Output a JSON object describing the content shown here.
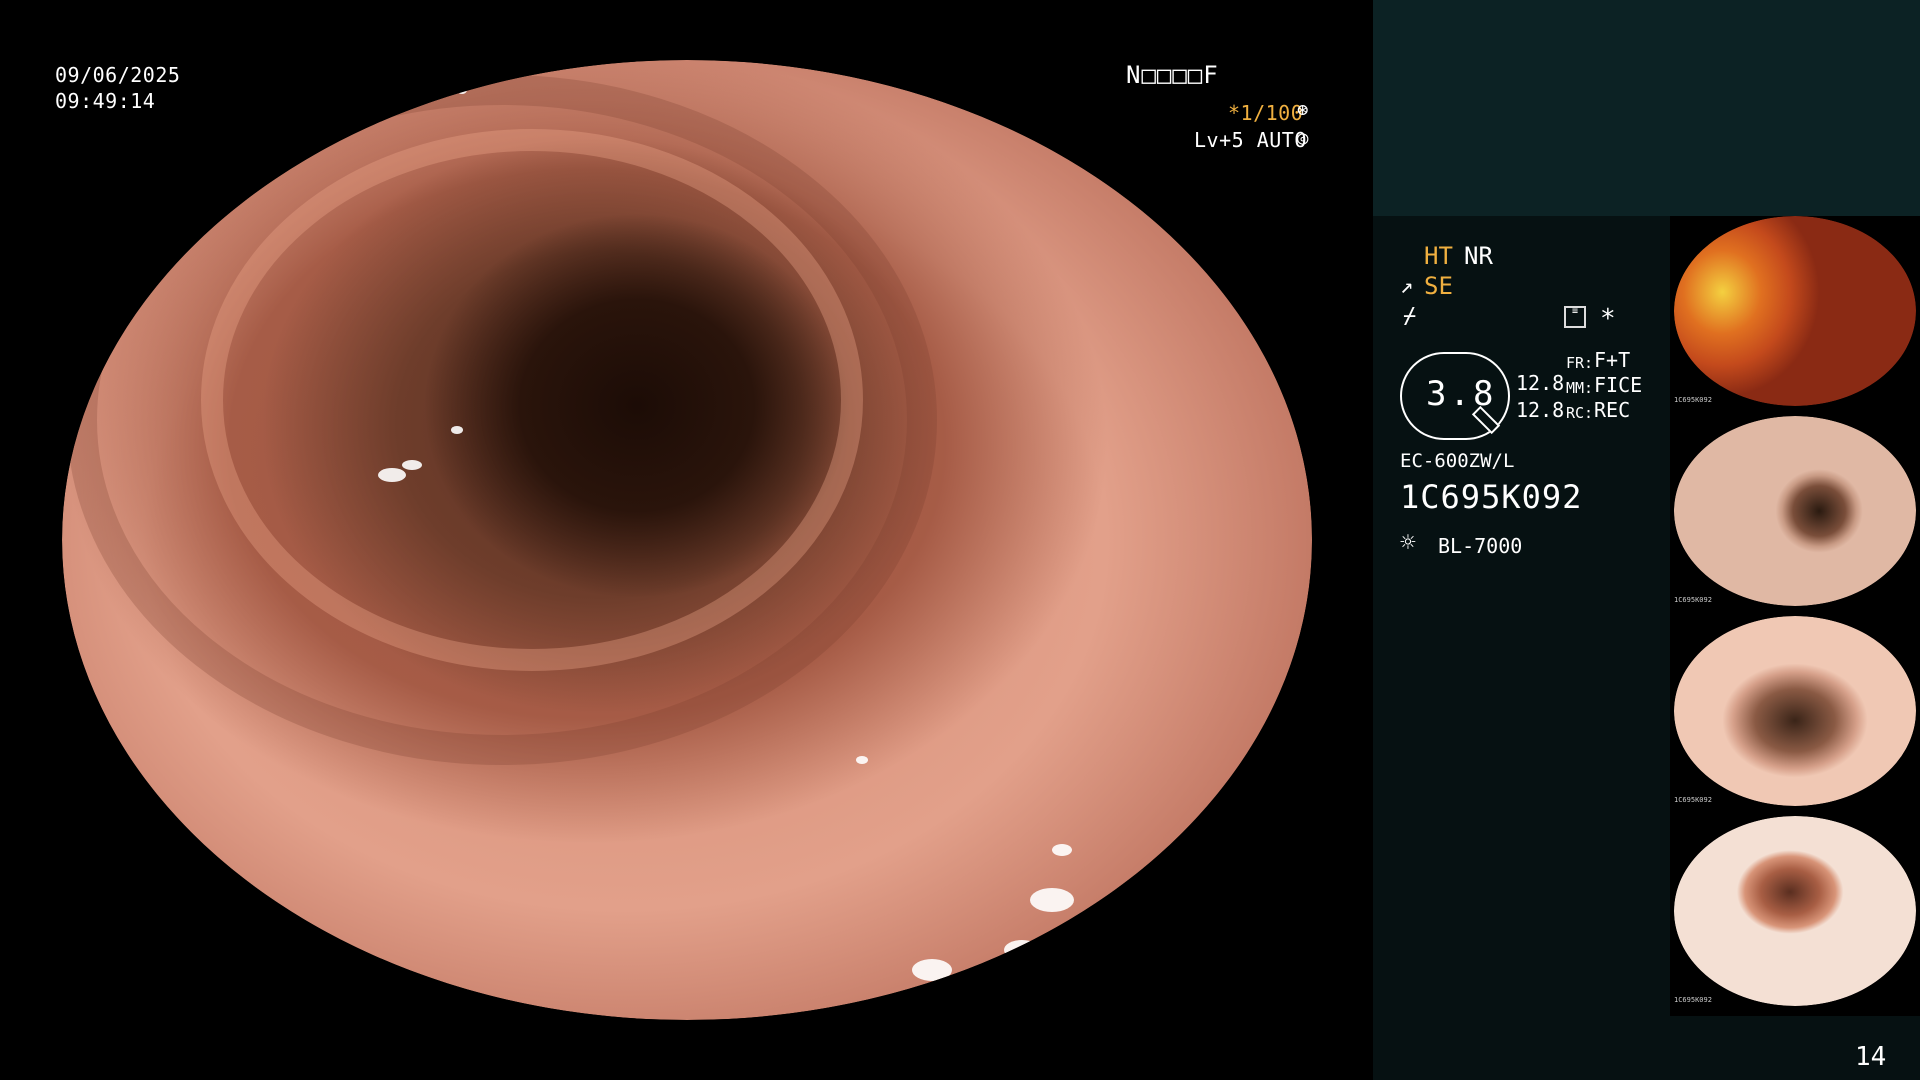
{
  "overlay": {
    "date": "09/06/2025",
    "time": "09:49:14",
    "patient_code": "N□□□□F",
    "shutter": "*1/100",
    "shutter_icon": "⊛",
    "level": "Lv+5 AUTO",
    "level_icon": "◎"
  },
  "panel": {
    "ht": "HT",
    "nr": "NR",
    "se_icon": "↗",
    "se": "SE",
    "f_icon": "⌿",
    "star": "*",
    "zoom": "3.8",
    "value1": "12.8",
    "value2": "12.8",
    "fr_label": "FR:",
    "fr_value": "F+T",
    "mm_label": "MM:",
    "mm_value": "FICE",
    "rc_label": "RC:",
    "rc_value": "REC",
    "scope_model": "EC-600ZW/L",
    "scope_serial": "1C695K092",
    "light_icon": "☼",
    "light_model": "BL-7000",
    "page_number": "14"
  },
  "thumbnails": [
    {
      "caption": "1C695K092"
    },
    {
      "caption": "1C695K092"
    },
    {
      "caption": "1C695K092"
    },
    {
      "caption": "1C695K092"
    }
  ],
  "colors": {
    "accent_orange": "#f0b040",
    "panel_bg": "#061112",
    "panel_top_bg": "#0c2224"
  }
}
